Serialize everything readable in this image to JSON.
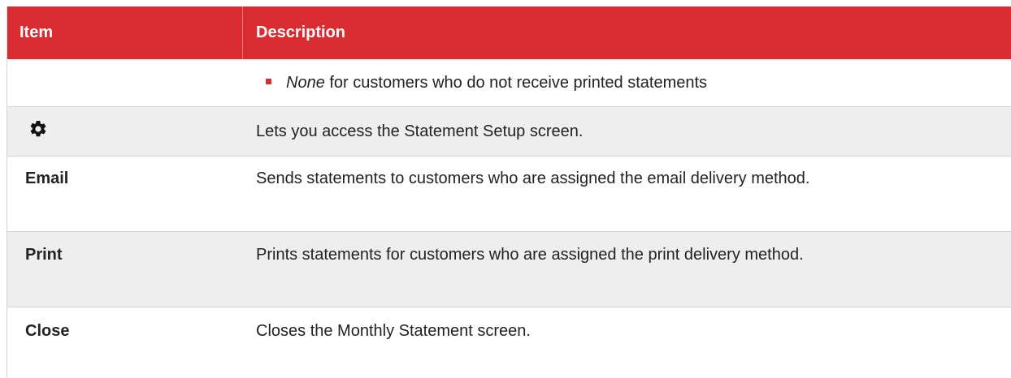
{
  "header": {
    "item": "Item",
    "description": "Description"
  },
  "rows": [
    {
      "item": "",
      "desc_em": "None",
      "desc_rest": " for customers who do not receive printed statements"
    },
    {
      "item_icon": "gear-icon",
      "description": "Lets you access the Statement Setup screen."
    },
    {
      "item": "Email",
      "description": "Sends statements to customers who are assigned the email delivery method."
    },
    {
      "item": "Print",
      "description": "Prints statements for customers who are assigned the print delivery method."
    },
    {
      "item": "Close",
      "description": "Closes the Monthly Statement screen."
    }
  ],
  "colors": {
    "header_bg": "#d92b30",
    "bullet": "#d92b30",
    "alt_row": "#eeeeee"
  }
}
